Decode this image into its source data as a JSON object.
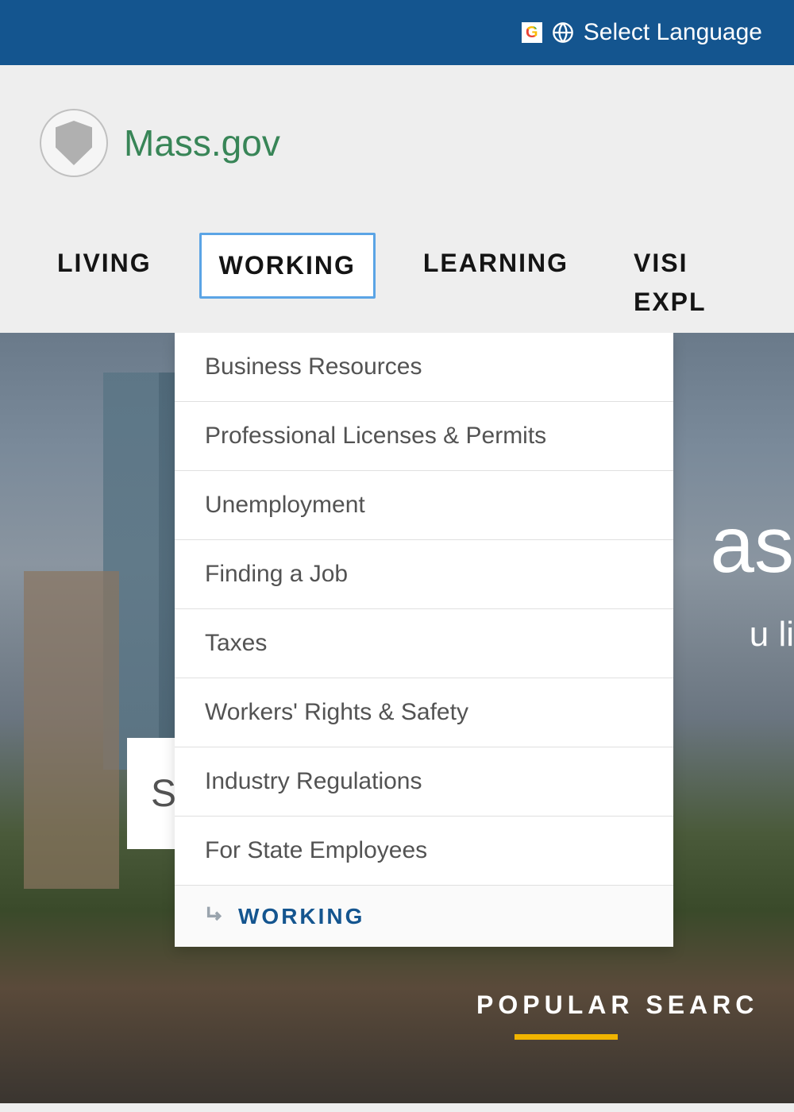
{
  "topbar": {
    "select_language": "Select Language"
  },
  "header": {
    "site_name": "Mass.gov"
  },
  "nav": {
    "items": [
      {
        "label": "LIVING",
        "active": false
      },
      {
        "label": "WORKING",
        "active": true
      },
      {
        "label": "LEARNING",
        "active": false
      }
    ],
    "right_stack": [
      {
        "label": "VISI"
      },
      {
        "label": "EXPL"
      }
    ]
  },
  "dropdown": {
    "items": [
      {
        "label": "Business Resources"
      },
      {
        "label": "Professional Licenses & Permits"
      },
      {
        "label": "Unemployment"
      },
      {
        "label": "Finding a Job"
      },
      {
        "label": "Taxes"
      },
      {
        "label": "Workers' Rights & Safety"
      },
      {
        "label": "Industry Regulations"
      },
      {
        "label": "For State Employees"
      }
    ],
    "footer_label": "WORKING"
  },
  "hero": {
    "title_fragment": "as",
    "sub_fragment": "u li",
    "search_fragment": "S",
    "popular_searches": "POPULAR SEARC"
  }
}
